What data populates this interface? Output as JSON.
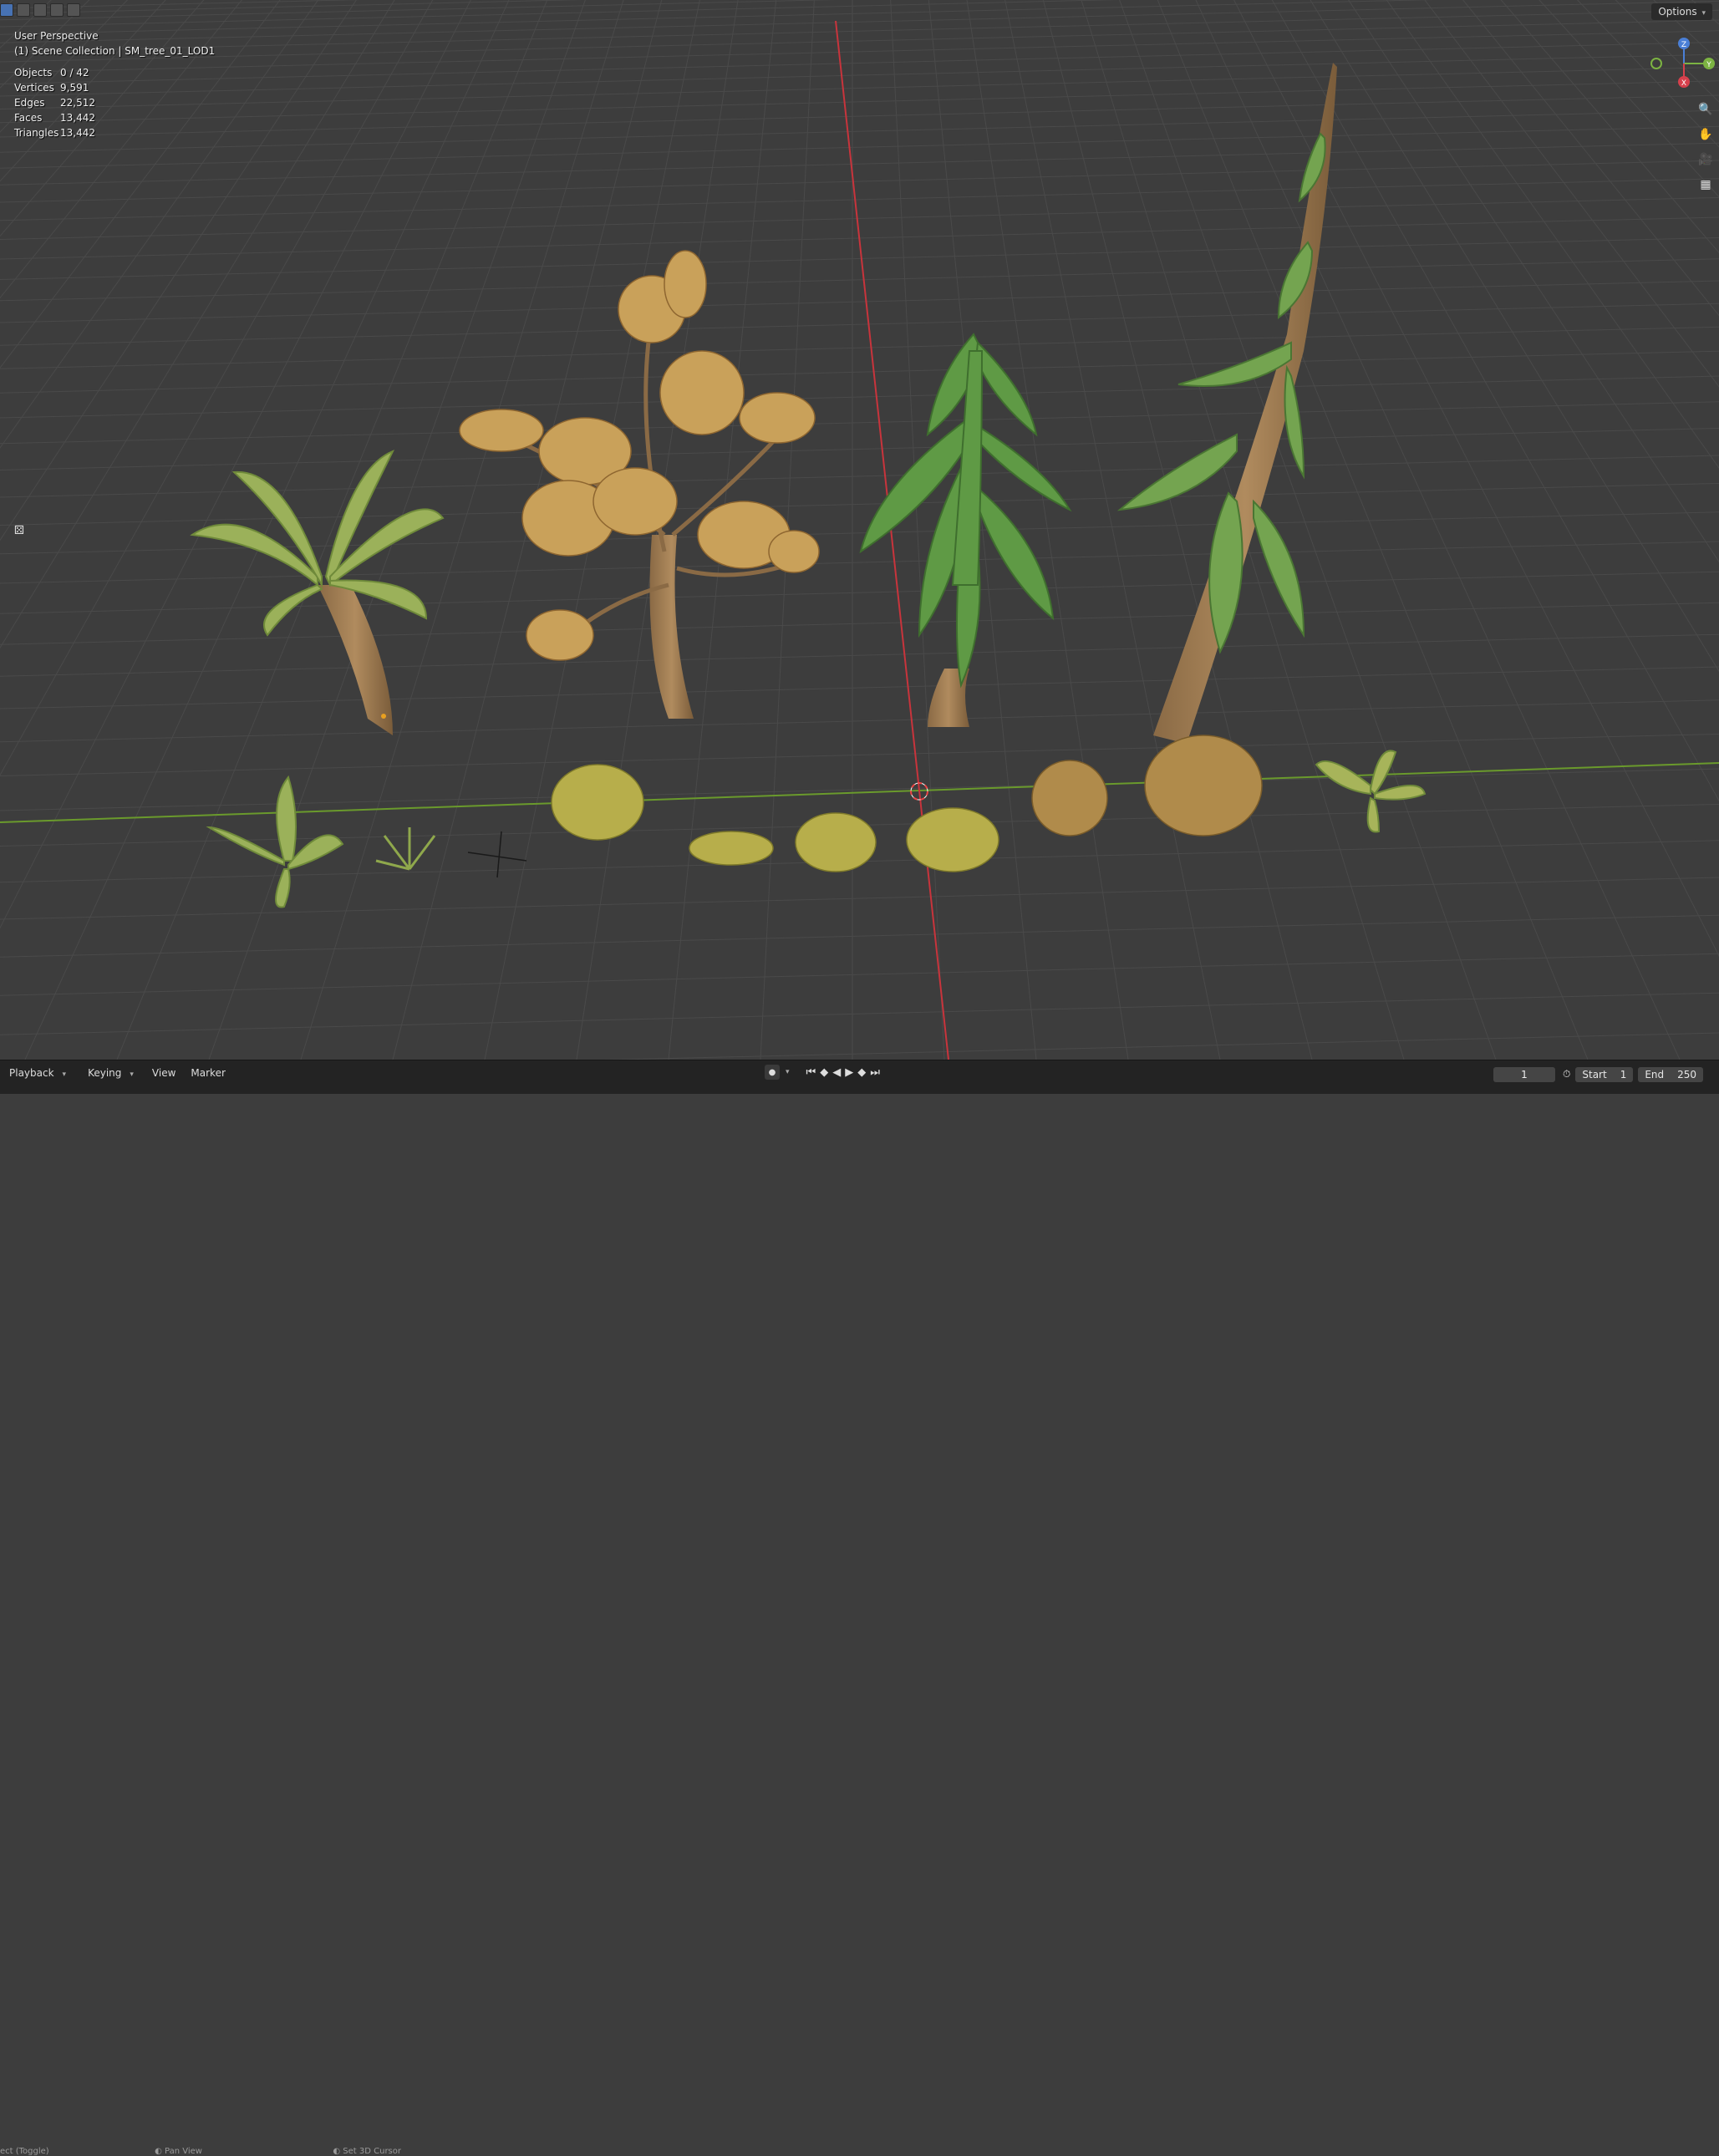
{
  "viewport": {
    "view_name": "User Perspective",
    "collection_label": "(1) Scene Collection | SM_tree_01_LOD1",
    "stats": [
      {
        "key": "Objects",
        "value": "0 / 42"
      },
      {
        "key": "Vertices",
        "value": "9,591"
      },
      {
        "key": "Edges",
        "value": "22,512"
      },
      {
        "key": "Faces",
        "value": "13,442"
      },
      {
        "key": "Triangles",
        "value": "13,442"
      }
    ],
    "options_label": "Options",
    "gizmo": {
      "z": "Z",
      "y": "Y",
      "x": "X"
    }
  },
  "timeline": {
    "menus": [
      "Playback",
      "Keying",
      "View",
      "Marker"
    ],
    "current_frame": "1",
    "start_label": "Start",
    "start_value": "1",
    "end_label": "End",
    "end_value": "250"
  },
  "statusbar": {
    "left": "ect (Toggle)",
    "middle": "Pan View",
    "right": "Set 3D Cursor"
  },
  "colors": {
    "viewport_bg": "#3d3d3d",
    "grid": "#4a4a4a",
    "x_axis": "#c8343c",
    "y_axis": "#6a9a2c",
    "accent": "#4772b3"
  },
  "icons": [
    "select-box-icon",
    "zoom-icon",
    "hand-icon",
    "camera-icon",
    "grid-icon",
    "cursor-icon",
    "play-icon",
    "jump-start-icon",
    "jump-end-icon",
    "keyframe-icon"
  ]
}
